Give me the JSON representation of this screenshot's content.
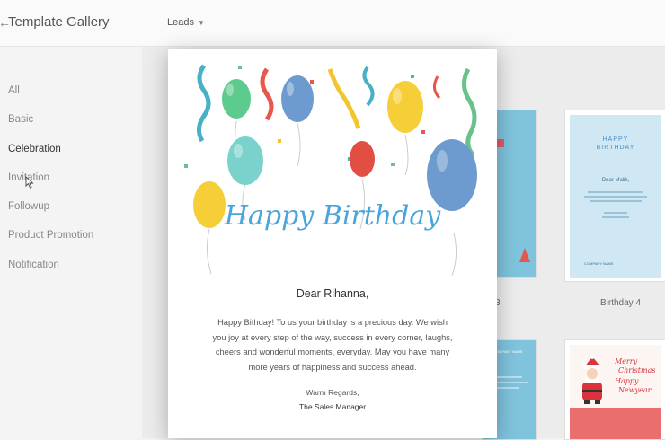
{
  "header": {
    "title": "Template Gallery",
    "module_label": "Leads"
  },
  "sidebar": {
    "items": [
      {
        "label": "All"
      },
      {
        "label": "Basic"
      },
      {
        "label": "Celebration",
        "active": true
      },
      {
        "label": "Invitation"
      },
      {
        "label": "Followup"
      },
      {
        "label": "Product Promotion"
      },
      {
        "label": "Notification"
      }
    ]
  },
  "gallery": {
    "cards": [
      {
        "name": "3",
        "mini_text": ""
      },
      {
        "name": "Birthday 4",
        "mini_lines": [
          "HAPPY",
          "BIRTHDAY",
          "Dear Malik,"
        ],
        "mini_logo": "COMPANY NAME"
      },
      {
        "name": "",
        "mini_logo": "COMPANY NAME"
      },
      {
        "name": "",
        "mini_lines": [
          "Merry",
          "Christmas",
          "Happy",
          "Newyear"
        ]
      }
    ]
  },
  "preview": {
    "banner_title": "Happy Birthday",
    "greeting": "Dear Rihanna,",
    "body": "Happy Bithday! To us your birthday is a precious day. We wish you joy at every step of the way, success in every corner, laughs, cheers and wonderful moments, everyday. May you have many more years of happiness and success ahead.",
    "regards": "Warm Regards,",
    "signer": "The Sales Manager"
  },
  "colors": {
    "accent_blue": "#4aa6da",
    "card_light_blue": "#cfe8f4",
    "xmas_red": "#ea6e6e"
  }
}
